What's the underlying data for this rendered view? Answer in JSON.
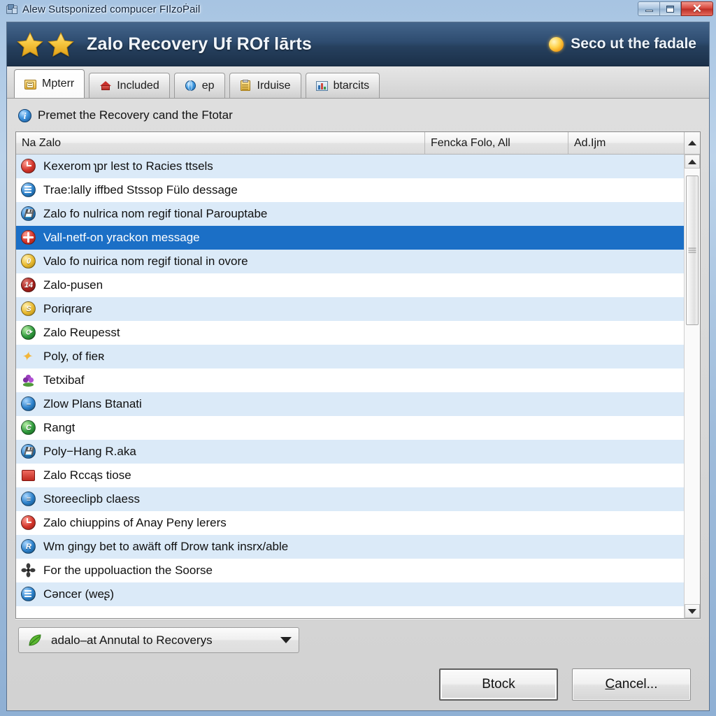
{
  "window": {
    "titlebar_text": "Alew Sutsponized compucer FIlzoṖail",
    "title_icon": "computer-alert-icon",
    "controls": {
      "minimize": "minimize-button",
      "maximize": "maximize-button",
      "close": "✕"
    }
  },
  "banner": {
    "title": "Zalo Recovery Uf ROf lārts",
    "left_icons": [
      "star-icon",
      "star-icon"
    ],
    "right_icon": "sun-icon",
    "right_label": "Seco ut the fadale"
  },
  "tabs": [
    {
      "label": "Mpterr",
      "icon": "folder-note-icon",
      "active": true
    },
    {
      "label": "Included",
      "icon": "home-icon",
      "active": false
    },
    {
      "label": "ep",
      "icon": "globe-icon",
      "active": false
    },
    {
      "label": "Irduise",
      "icon": "clipboard-icon",
      "active": false
    },
    {
      "label": "btarcits",
      "icon": "chart-icon",
      "active": false
    }
  ],
  "info": {
    "icon": "info-icon",
    "glyph": "i",
    "text": "Premet the Recovery cand the Ftotar"
  },
  "list": {
    "columns": [
      "Na Zalo",
      "Fencka Folo, All",
      "Ad.Ijm"
    ],
    "rows": [
      {
        "label": "Kexerom ʅpr lest to Racies ttsels",
        "icon": "red-clock-badge-icon",
        "selected": false
      },
      {
        "label": "Trae:lally iffbed Stssop Fülo dessage",
        "icon": "blue-doc-badge-icon",
        "selected": false
      },
      {
        "label": "Zalo fo nulrica nom regif tional Parouptabe",
        "icon": "blue-save-badge-icon",
        "selected": false
      },
      {
        "label": "Vall-netf-on yrackon message",
        "icon": "red-plus-badge-icon",
        "selected": true
      },
      {
        "label": "Valo fo nuirica nom regif tional in ovore",
        "icon": "gold-zero-badge-icon",
        "selected": false
      },
      {
        "label": "Zalo-pusen",
        "icon": "darkred-14-badge-icon",
        "selected": false
      },
      {
        "label": "Poriqrare",
        "icon": "gold-s-badge-icon",
        "selected": false
      },
      {
        "label": "Zalo Reupesst",
        "icon": "green-badge-icon",
        "selected": false
      },
      {
        "label": "Poly, of fieʀ",
        "icon": "gold-star-icon",
        "selected": false
      },
      {
        "label": "Tetxibaf",
        "icon": "purple-flower-icon",
        "selected": false
      },
      {
        "label": "Zlow Plans Btanati",
        "icon": "blue-minus-badge-icon",
        "selected": false
      },
      {
        "label": "Rangt",
        "icon": "green-c-badge-icon",
        "selected": false
      },
      {
        "label": "Poly−Hang R.aka",
        "icon": "blue-save-badge-icon",
        "selected": false
      },
      {
        "label": "Zalo Rccąs tiose",
        "icon": "red-book-icon",
        "selected": false
      },
      {
        "label": "Storeeclipb claess",
        "icon": "blue-list-badge-icon",
        "selected": false
      },
      {
        "label": "Zalo chiuppins of Anay Peny lerers",
        "icon": "red-clock-badge-icon",
        "selected": false
      },
      {
        "label": "Wm gingy bet to awäft off Drow tank insrx/able",
        "icon": "blue-r-badge-icon",
        "selected": false
      },
      {
        "label": "For the uppoluaction the Soorse",
        "icon": "propeller-icon",
        "selected": false
      },
      {
        "label": "Cəncer (weʂ)",
        "icon": "blue-doc-badge-icon",
        "selected": false
      }
    ],
    "scroll": {
      "up_arrow": "scroll-up-arrow",
      "down_arrow": "scroll-down-arrow",
      "thumb": "scroll-thumb"
    }
  },
  "combo": {
    "icon": "green-leaf-icon",
    "value": "adalo–at Annutal to Recoverys",
    "caret": "chevron-down-icon"
  },
  "buttons": {
    "primary": "Btock",
    "secondary_prefix": "C",
    "secondary_rest": "ancel..."
  },
  "colors": {
    "selection_blue": "#1b6fc6",
    "row_alt_blue": "#dbeaf8",
    "banner_dark": "#2e4c70",
    "dialog_gray": "#d7d7d7",
    "close_red": "#d6453a"
  }
}
